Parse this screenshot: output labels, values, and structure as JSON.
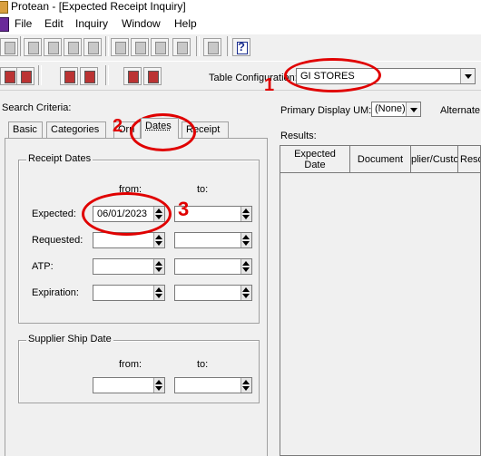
{
  "window": {
    "title": "Protean - [Expected Receipt Inquiry]"
  },
  "menu": [
    "File",
    "Edit",
    "Inquiry",
    "Window",
    "Help"
  ],
  "toolbar": {
    "help_label": "?"
  },
  "table_configuration": {
    "label": "Table Configuration:",
    "value": "GI STORES"
  },
  "search_criteria": {
    "label": "Search Criteria:",
    "tabs": [
      "Basic",
      "Categories",
      "Dates",
      "Receipt"
    ],
    "hidden_tab_fragment": "Orri",
    "active_tab": "Dates",
    "receipt_dates": {
      "title": "Receipt Dates",
      "from_label": "from:",
      "to_label": "to:",
      "rows": [
        {
          "label": "Expected:",
          "from": "06/01/2023",
          "to": ""
        },
        {
          "label": "Requested:",
          "from": "",
          "to": ""
        },
        {
          "label": "ATP:",
          "from": "",
          "to": ""
        },
        {
          "label": "Expiration:",
          "from": "",
          "to": ""
        }
      ]
    },
    "supplier_ship_date": {
      "title": "Supplier Ship Date",
      "from_label": "from:",
      "to_label": "to:",
      "from": "",
      "to": ""
    }
  },
  "display": {
    "primary_um_label": "Primary Display UM:",
    "primary_um_value": "(None)",
    "alternate_label": "Alternate"
  },
  "results": {
    "label": "Results:",
    "columns": [
      "Expected Date",
      "Document",
      "plier/Custo",
      "Reso"
    ]
  },
  "annotations": {
    "numbers": [
      "1",
      "2",
      "3"
    ],
    "color": "#e00000"
  }
}
